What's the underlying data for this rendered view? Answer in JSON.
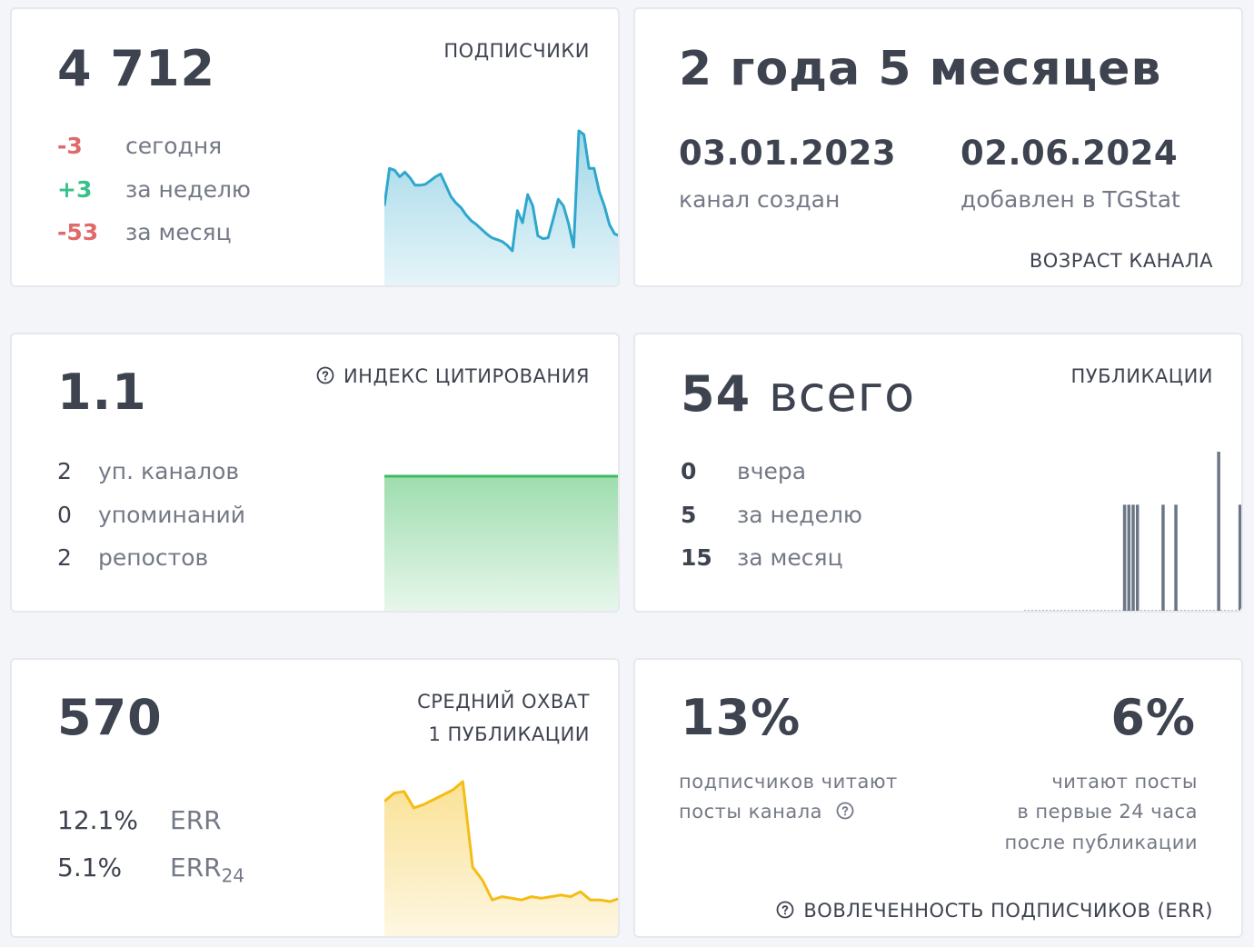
{
  "subscribers": {
    "value": "4 712",
    "title": "ПОДПИСЧИКИ",
    "rows": [
      {
        "delta": "-3",
        "label": "сегодня",
        "tone": "red"
      },
      {
        "delta": "+3",
        "label": "за неделю",
        "tone": "green"
      },
      {
        "delta": "-53",
        "label": "за месяц",
        "tone": "red"
      }
    ]
  },
  "age": {
    "value": "2 года 5 месяцев",
    "created_date": "03.01.2023",
    "created_label": "канал создан",
    "added_date": "02.06.2024",
    "added_label": "добавлен в TGStat",
    "title": "ВОЗРАСТ КАНАЛА"
  },
  "citation": {
    "value": "1.1",
    "title": "ИНДЕКС ЦИТИРОВАНИЯ",
    "help_icon": "question-circle-icon",
    "rows": [
      {
        "num": "2",
        "label": "уп. каналов"
      },
      {
        "num": "0",
        "label": "упоминаний"
      },
      {
        "num": "2",
        "label": "репостов"
      }
    ]
  },
  "publications": {
    "value_num": "54",
    "value_word": "всего",
    "title": "ПУБЛИКАЦИИ",
    "rows": [
      {
        "num": "0",
        "label": "вчера"
      },
      {
        "num": "5",
        "label": "за неделю"
      },
      {
        "num": "15",
        "label": "за месяц"
      }
    ]
  },
  "reach": {
    "value": "570",
    "title_line1": "СРЕДНИЙ ОХВАТ",
    "title_line2": "1 ПУБЛИКАЦИИ",
    "err_value": "12.1%",
    "err_label": "ERR",
    "err24_value": "5.1%",
    "err24_label": "ERR",
    "err24_sub": "24"
  },
  "engagement": {
    "left_value": "13%",
    "left_line1": "подписчиков читают",
    "left_line2": "посты канала",
    "right_value": "6%",
    "right_line1": "читают посты",
    "right_line2": "в первые 24 часа",
    "right_line3": "после публикации",
    "title": "ВОВЛЕЧЕННОСТЬ ПОДПИСЧИКОВ (ERR)"
  },
  "colors": {
    "subs_line": "#2fa7cc",
    "citation_line": "#3dbb5e",
    "pub_bars": "#6b7785",
    "reach_line": "#f4bd14",
    "negative": "#e06a6a",
    "positive": "#3cc08b"
  },
  "chart_data": [
    {
      "type": "area",
      "name": "subscribers-sparkline",
      "values": [
        4760,
        4800,
        4798,
        4791,
        4796,
        4790,
        4782,
        4782,
        4783,
        4787,
        4791,
        4794,
        4782,
        4770,
        4763,
        4758,
        4750,
        4744,
        4740,
        4735,
        4730,
        4726,
        4724,
        4722,
        4718,
        4712,
        4755,
        4742,
        4772,
        4760,
        4728,
        4725,
        4726,
        4746,
        4767,
        4760,
        4741,
        4716,
        4840,
        4836,
        4800,
        4800,
        4775,
        4760,
        4740,
        4730,
        4728
      ]
    },
    {
      "type": "area",
      "name": "citation-index",
      "values": [
        1.1,
        1.1
      ]
    },
    {
      "type": "bar",
      "name": "publications-per-day",
      "values": [
        0,
        0,
        0,
        0,
        0,
        0,
        0,
        0,
        0,
        0,
        0,
        0,
        0,
        0,
        0,
        0,
        0,
        0,
        0,
        0,
        0,
        0,
        0,
        2,
        2,
        2,
        2,
        0,
        0,
        0,
        0,
        0,
        2,
        0,
        0,
        2,
        0,
        0,
        0,
        0,
        0,
        0,
        0,
        0,
        0,
        3,
        0,
        0,
        0,
        0,
        2
      ]
    },
    {
      "type": "area",
      "name": "average-reach",
      "values": [
        540,
        565,
        570,
        520,
        530,
        545,
        560,
        575,
        600,
        340,
        300,
        240,
        250,
        245,
        240,
        250,
        245,
        250,
        255,
        250,
        265,
        240,
        240,
        235,
        245
      ]
    }
  ]
}
